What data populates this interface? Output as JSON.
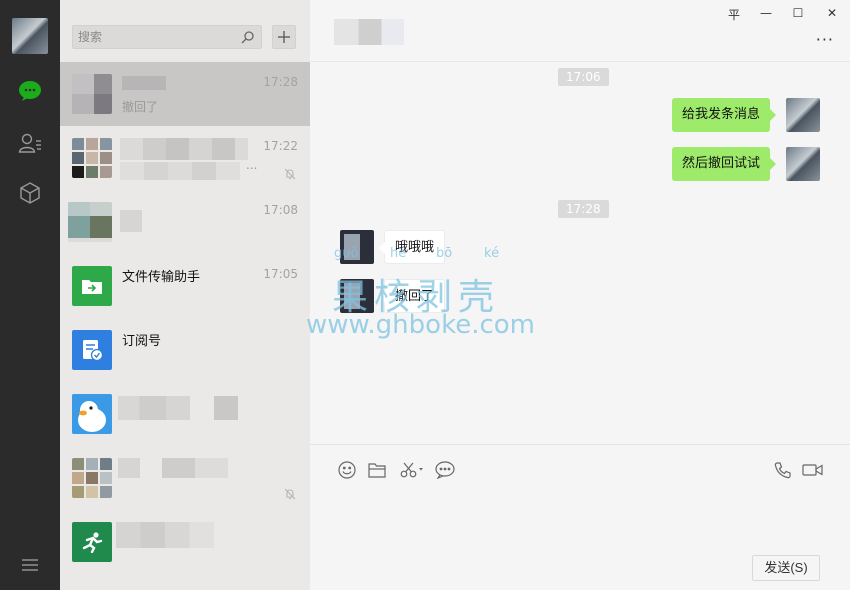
{
  "sidebar": {
    "icons": [
      "chat-icon",
      "contacts-icon",
      "favorites-icon",
      "menu-icon"
    ],
    "accent": "#1aad19"
  },
  "search": {
    "placeholder": "搜索"
  },
  "chats": [
    {
      "name": "",
      "preview": "撤回了",
      "time": "17:28",
      "muted": false
    },
    {
      "name": "",
      "preview": "...",
      "time": "17:22",
      "muted": true
    },
    {
      "name": "",
      "preview": "",
      "time": "17:08",
      "muted": false
    },
    {
      "name": "文件传输助手",
      "preview": "",
      "time": "17:05",
      "muted": false
    },
    {
      "name": "订阅号",
      "preview": "",
      "time": "",
      "muted": false
    },
    {
      "name": "",
      "preview": "",
      "time": "",
      "muted": false
    },
    {
      "name": "",
      "preview": "",
      "time": "",
      "muted": true
    },
    {
      "name": "",
      "preview": "",
      "time": "",
      "muted": false
    }
  ],
  "window": {
    "pin": "平",
    "minimize": "—",
    "maximize": "☐",
    "close": "✕",
    "more": "···"
  },
  "conversation": {
    "stamp1": "17:06",
    "out1": "给我发条消息",
    "out2": "然后撤回试试",
    "stamp2": "17:28",
    "in1": "哦哦哦",
    "in2": "撤回了"
  },
  "watermark": {
    "pinyin": [
      "guǒ",
      "hé",
      "bō",
      "ké"
    ],
    "text": "果核剥壳",
    "url": "www.ghboke.com"
  },
  "composer": {
    "send_label": "发送(S)"
  }
}
